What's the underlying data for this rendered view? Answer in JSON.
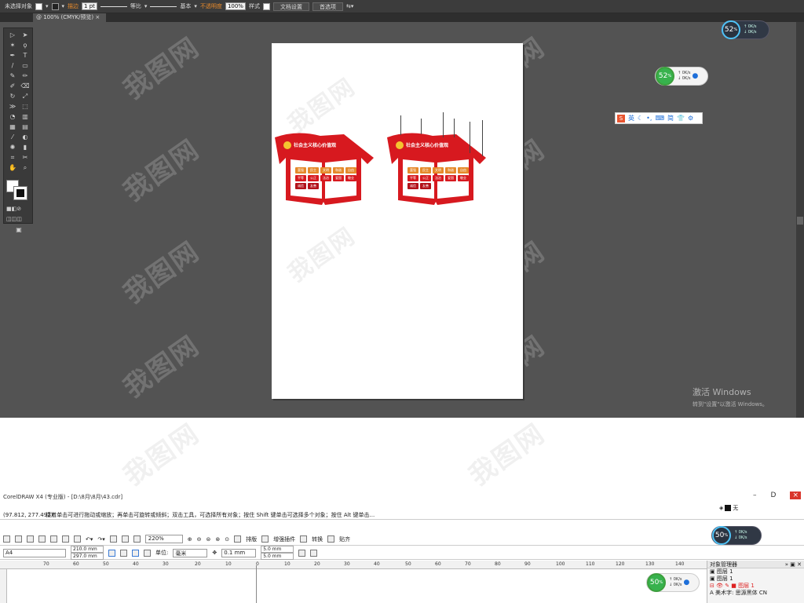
{
  "illustrator": {
    "control_bar": {
      "selection_label": "未选择对象",
      "stroke_label": "描边",
      "stroke_weight": "1 pt",
      "profile_label": "等比",
      "brush_label": "基本",
      "opacity_label": "不透明度",
      "opacity_value": "100%",
      "style_label": "样式",
      "doc_setup_button": "文档设置",
      "prefs_button": "首选项"
    },
    "doc_tab": "@ 100% (CMYK/预览)",
    "boards": [
      {
        "title": "社会主义核心价值观",
        "words": [
          "富强",
          "民主",
          "文明",
          "和谐",
          "自由",
          "平等",
          "公正",
          "法治",
          "爱国",
          "敬业",
          "诚信",
          "友善"
        ]
      },
      {
        "title": "社会主义核心价值观",
        "words": [
          "富强",
          "民主",
          "文明",
          "和谐",
          "自由",
          "平等",
          "公正",
          "法治",
          "爱国",
          "敬业",
          "诚信",
          "友善"
        ]
      }
    ],
    "windows_activation": {
      "title": "激活 Windows",
      "subtitle": "转到\"设置\"以激活 Windows。"
    },
    "watermark": "我图网"
  },
  "net_meter_dark": {
    "percent": "52",
    "unit": "%",
    "up": "0K/s",
    "down": "0K/s"
  },
  "net_meter_light": {
    "percent": "52",
    "unit": "%",
    "up": "0K/s",
    "down": "0K/s"
  },
  "ime_bar": {
    "lang": "英",
    "simplified": "简"
  },
  "coreldraw": {
    "title": "CorelDRAW X4 (专业版) - [D:\\8月\\8月\\43.cdr]",
    "coords": "(97.812, 277.492)",
    "hint": "接着单击可进行拖动或缩放；再单击可旋转或倾斜；双击工具，可选择所有对象；按住 Shift 键单击可选择多个对象；按住 Alt 键单击...",
    "fill_none": "无",
    "zoom": "220%",
    "toolbar_labels": [
      "排版",
      "增强插件",
      "转换",
      "贴齐"
    ],
    "page_size": "A4",
    "width": "210.0 mm",
    "height": "297.0 mm",
    "unit_label": "单位:",
    "unit_value": "毫米",
    "nudge": "0.1 mm",
    "dup_x": "5.0 mm",
    "dup_y": "5.0 mm",
    "ruler_ticks": [
      "70",
      "60",
      "50",
      "40",
      "30",
      "20",
      "10",
      "0",
      "10",
      "20",
      "30",
      "40",
      "50",
      "60",
      "70",
      "80",
      "90",
      "100",
      "110",
      "120",
      "130",
      "140"
    ],
    "object_manager": {
      "title": "对象管理器",
      "layers": [
        "图层 1",
        "图层 1"
      ],
      "active_layer": "图层 1",
      "text_item": "A 美术字: 思源黑体 CN"
    },
    "net_meter_dark": {
      "percent": "50",
      "unit": "%",
      "up": "0K/s",
      "down": "0K/s"
    },
    "net_meter_light": {
      "percent": "50",
      "unit": "%",
      "up": "0K/s",
      "down": "0K/s"
    }
  },
  "colors": {
    "flag_red": "#d7191f",
    "gold": "#f4c430",
    "orange": "#e5892b"
  }
}
